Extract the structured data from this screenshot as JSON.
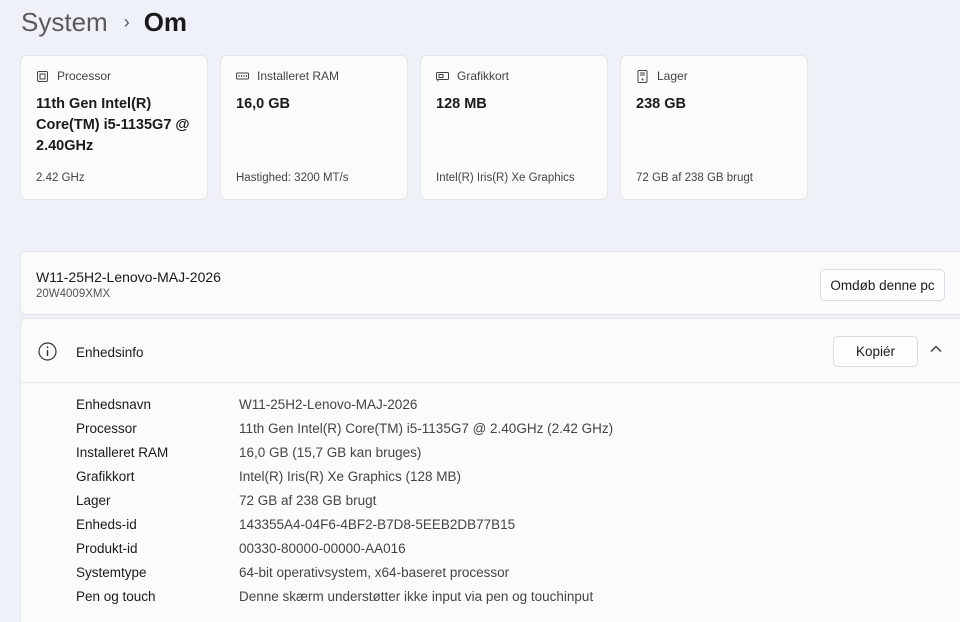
{
  "breadcrumb": {
    "parent": "System",
    "separator": "›",
    "current": "Om"
  },
  "cards": [
    {
      "icon": "processor-icon",
      "title": "Processor",
      "value": "11th Gen Intel(R) Core(TM) i5-1135G7 @ 2.40GHz",
      "sub": "2.42 GHz"
    },
    {
      "icon": "ram-icon",
      "title": "Installeret RAM",
      "value": "16,0 GB",
      "sub": "Hastighed: 3200 MT/s"
    },
    {
      "icon": "gpu-icon",
      "title": "Grafikkort",
      "value": "128 MB",
      "sub": "Intel(R) Iris(R) Xe Graphics"
    },
    {
      "icon": "storage-icon",
      "title": "Lager",
      "value": "238 GB",
      "sub": "72 GB af 238 GB brugt"
    }
  ],
  "pc": {
    "name": "W11-25H2-Lenovo-MAJ-2026",
    "model": "20W4009XMX",
    "rename_label": "Omdøb denne pc"
  },
  "device_info": {
    "title": "Enhedsinfo",
    "copy_label": "Kopiér",
    "specs": [
      {
        "label": "Enhedsnavn",
        "value": "W11-25H2-Lenovo-MAJ-2026"
      },
      {
        "label": "Processor",
        "value": "11th Gen Intel(R) Core(TM) i5-1135G7 @ 2.40GHz (2.42 GHz)"
      },
      {
        "label": "Installeret RAM",
        "value": "16,0 GB (15,7 GB kan bruges)"
      },
      {
        "label": "Grafikkort",
        "value": "Intel(R) Iris(R) Xe Graphics (128 MB)"
      },
      {
        "label": "Lager",
        "value": "72 GB af 238 GB brugt"
      },
      {
        "label": "Enheds-id",
        "value": "143355A4-04F6-4BF2-B7D8-5EEB2DB77B15"
      },
      {
        "label": "Produkt-id",
        "value": "00330-80000-00000-AA016"
      },
      {
        "label": "Systemtype",
        "value": "64-bit operativsystem, x64-baseret processor"
      },
      {
        "label": "Pen og touch",
        "value": "Denne skærm understøtter ikke input via pen og touchinput"
      }
    ]
  },
  "colors": {
    "background": "#eef1f7",
    "card": "#fbfbfc",
    "border": "#e3e5ea"
  }
}
